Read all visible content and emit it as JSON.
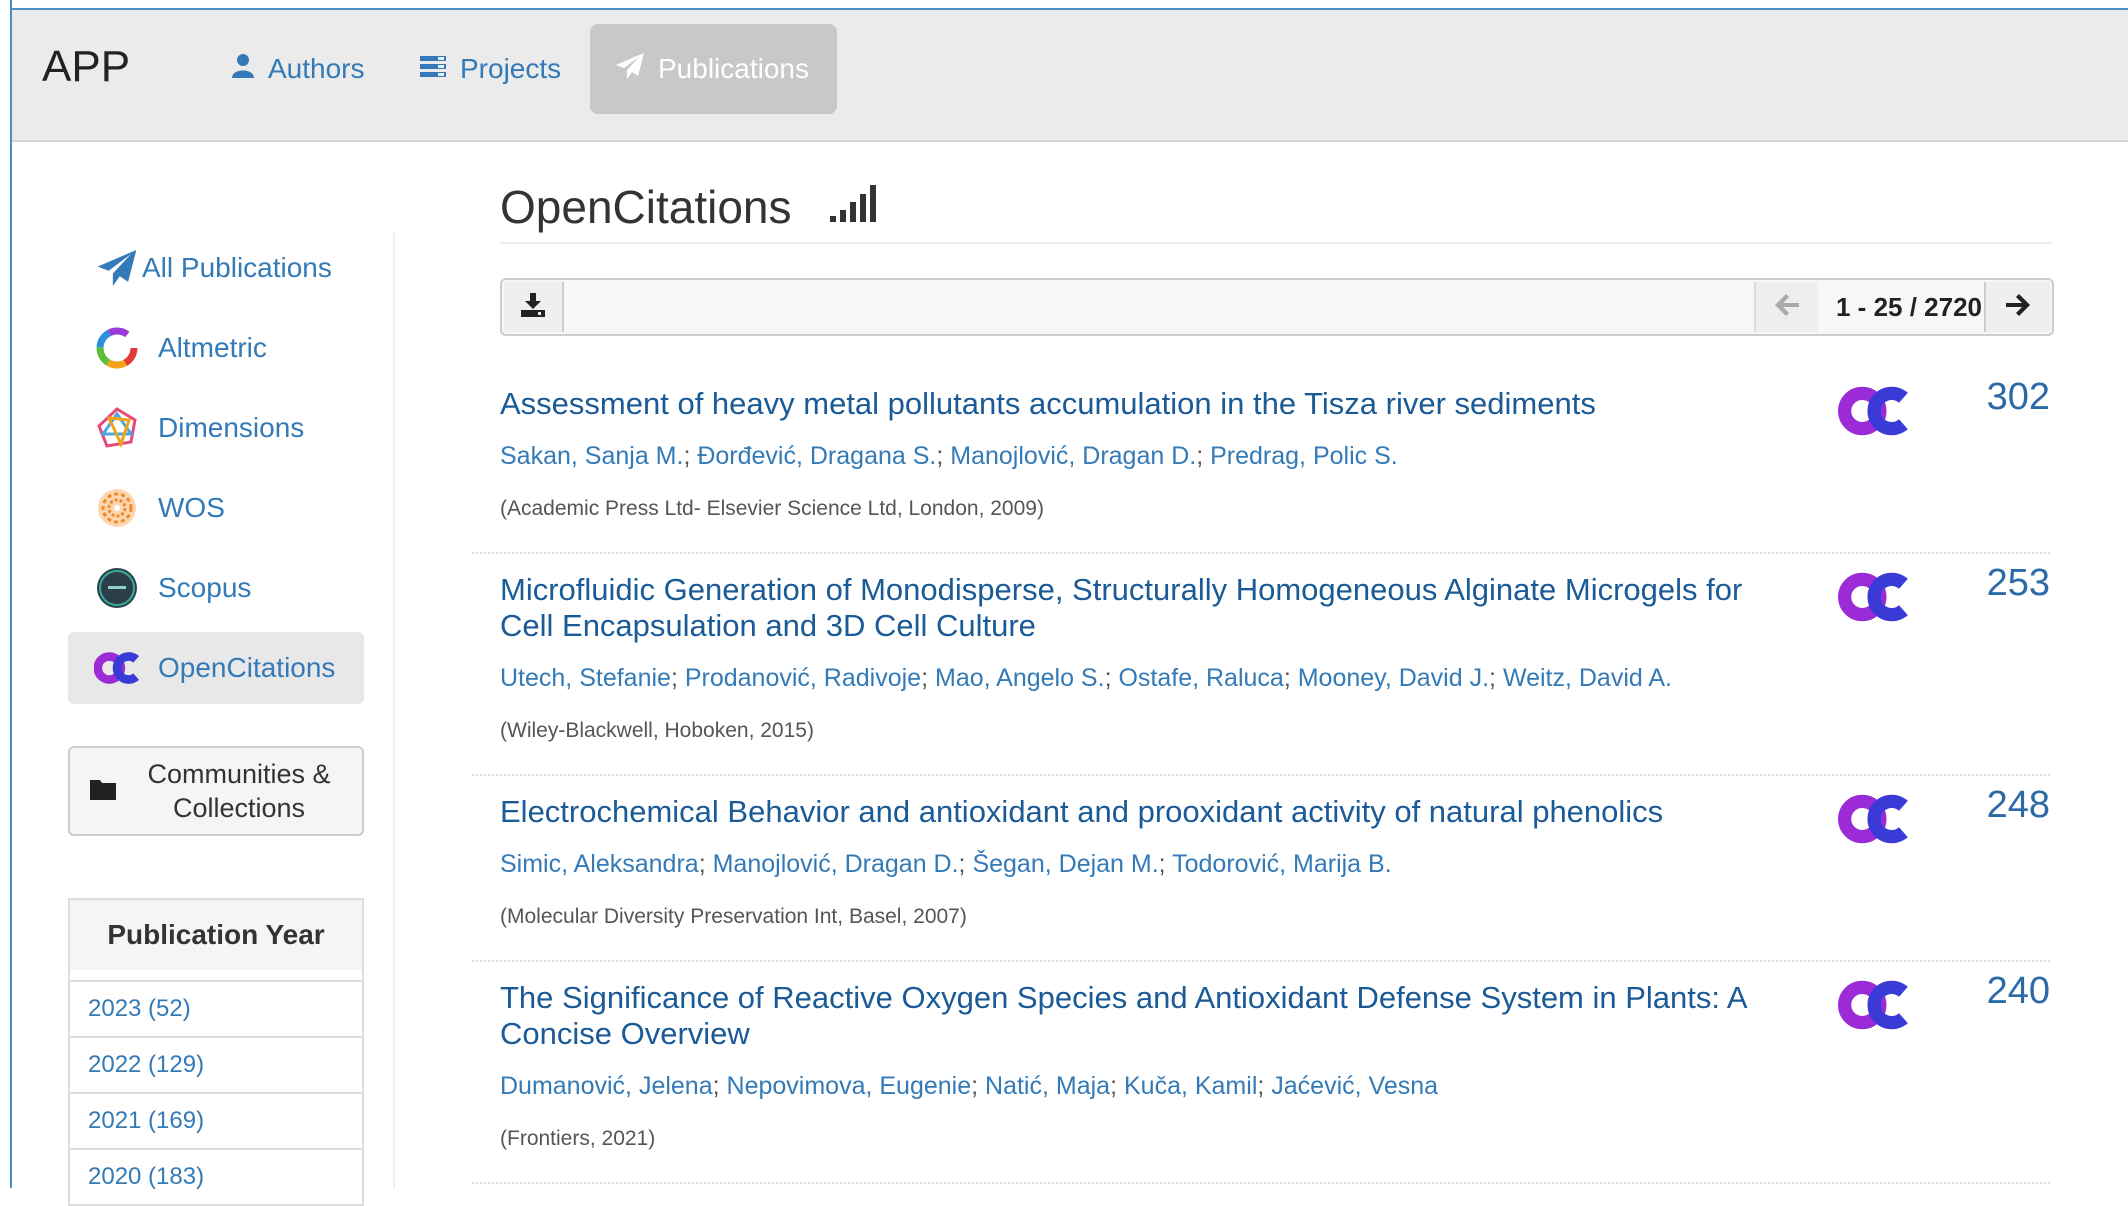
{
  "navbar": {
    "brand": "APP",
    "items": [
      {
        "label": "Authors",
        "icon": "user-icon"
      },
      {
        "label": "Projects",
        "icon": "tasks-icon"
      },
      {
        "label": "Publications",
        "icon": "paper-plane-icon",
        "active": true
      }
    ]
  },
  "sidebar": {
    "items": [
      {
        "label": "All Publications",
        "icon": "paper-plane-icon"
      },
      {
        "label": "Altmetric",
        "icon": "altmetric-icon"
      },
      {
        "label": "Dimensions",
        "icon": "dimensions-icon"
      },
      {
        "label": "WOS",
        "icon": "wos-icon"
      },
      {
        "label": "Scopus",
        "icon": "scopus-icon"
      },
      {
        "label": "OpenCitations",
        "icon": "opencitations-icon",
        "active": true
      }
    ],
    "communities_label_1": "Communities &",
    "communities_label_2": "Collections",
    "year_panel": {
      "heading": "Publication Year",
      "rows": [
        "2023 (52)",
        "2022 (129)",
        "2021 (169)",
        "2020 (183)"
      ]
    }
  },
  "main": {
    "title": "OpenCitations",
    "pager": "1 - 25 / 2720",
    "publications": [
      {
        "title": "Assessment of heavy metal pollutants accumulation in the Tisza river sediments",
        "authors": [
          "Sakan, Sanja M.",
          "Đorđević, Dragana S.",
          "Manojlović, Dragan D.",
          "Predrag, Polic S."
        ],
        "meta": "(Academic Press Ltd- Elsevier Science Ltd, London, 2009)",
        "count": "302"
      },
      {
        "title": "Microfluidic Generation of Monodisperse, Structurally Homogeneous Alginate Microgels for Cell Encapsulation and 3D Cell Culture",
        "authors": [
          "Utech, Stefanie",
          "Prodanović, Radivoje",
          "Mao, Angelo S.",
          "Ostafe, Raluca",
          "Mooney, David J.",
          "Weitz, David A."
        ],
        "meta": "(Wiley-Blackwell, Hoboken, 2015)",
        "count": "253"
      },
      {
        "title": "Electrochemical Behavior and antioxidant and prooxidant activity of natural phenolics",
        "authors": [
          "Simic, Aleksandra",
          "Manojlović, Dragan D.",
          "Šegan, Dejan M.",
          "Todorović, Marija B."
        ],
        "meta": "(Molecular Diversity Preservation Int, Basel, 2007)",
        "count": "248"
      },
      {
        "title": "The Significance of Reactive Oxygen Species and Antioxidant Defense System in Plants: A Concise Overview",
        "authors": [
          "Dumanović, Jelena",
          "Nepovimova, Eugenie",
          "Natić, Maja",
          "Kuča, Kamil",
          "Jaćević, Vesna"
        ],
        "meta": "(Frontiers, 2021)",
        "count": "240"
      }
    ]
  },
  "colors": {
    "link": "#337ab7",
    "opencitations_purple": "#9a2bd6",
    "opencitations_blue": "#3a3ad6"
  }
}
